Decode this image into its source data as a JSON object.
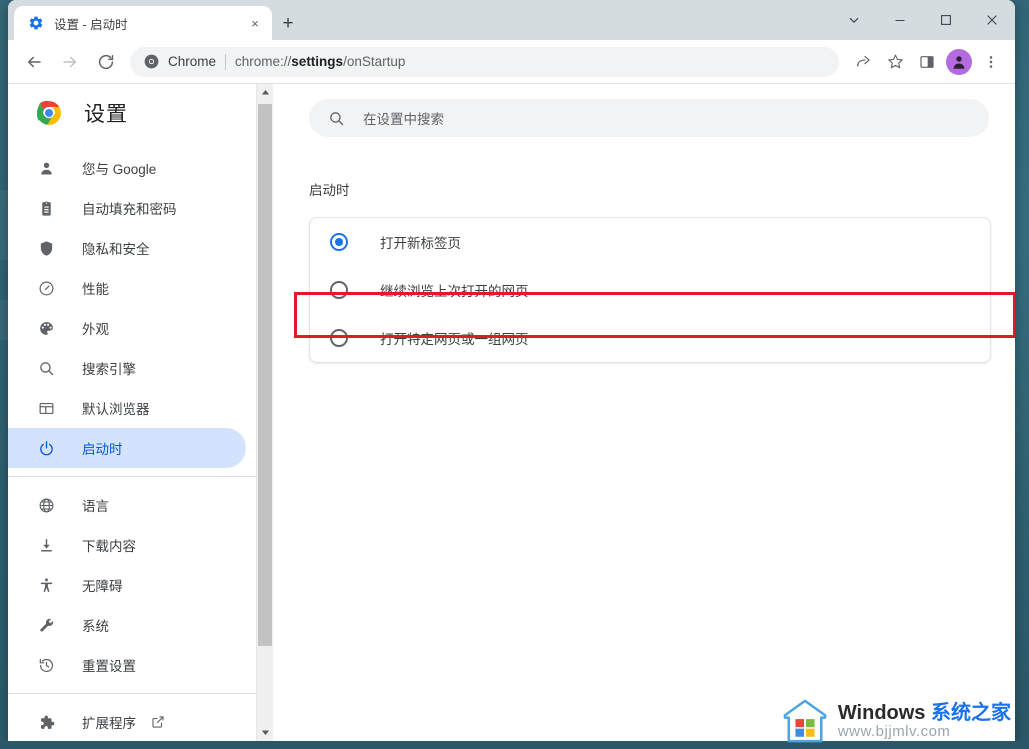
{
  "window": {
    "controls": [
      {
        "name": "tab-search-button",
        "glyph": "chevron-down"
      },
      {
        "name": "minimize-button",
        "glyph": "minimize"
      },
      {
        "name": "maximize-button",
        "glyph": "maximize"
      },
      {
        "name": "close-button",
        "glyph": "close"
      }
    ]
  },
  "tab": {
    "title": "设置 - 启动时",
    "favicon": "gear-icon",
    "close_label": "×",
    "new_tab_label": "+"
  },
  "toolbar": {
    "back_label": "←",
    "forward_label": "→",
    "reload_label": "↻",
    "omnibox": {
      "scheme_label": "Chrome",
      "url_prefix": "chrome://",
      "url_bold": "settings",
      "url_suffix": "/onStartup",
      "full_url": "chrome://settings/onStartup"
    },
    "icons": [
      {
        "name": "share-icon"
      },
      {
        "name": "bookmark-star-icon"
      },
      {
        "name": "side-panel-icon"
      },
      {
        "name": "profile-avatar"
      },
      {
        "name": "chrome-menu-icon"
      }
    ]
  },
  "sidebar": {
    "brand_title": "设置",
    "brand_logo": "chrome-logo",
    "items": [
      {
        "label": "您与 Google",
        "icon": "person-icon",
        "selected": false
      },
      {
        "label": "自动填充和密码",
        "icon": "clipboard-icon",
        "selected": false
      },
      {
        "label": "隐私和安全",
        "icon": "shield-icon",
        "selected": false
      },
      {
        "label": "性能",
        "icon": "speedometer-icon",
        "selected": false
      },
      {
        "label": "外观",
        "icon": "palette-icon",
        "selected": false
      },
      {
        "label": "搜索引擎",
        "icon": "search-icon",
        "selected": false
      },
      {
        "label": "默认浏览器",
        "icon": "browser-window-icon",
        "selected": false
      },
      {
        "label": "启动时",
        "icon": "power-icon",
        "selected": true
      }
    ],
    "items2": [
      {
        "label": "语言",
        "icon": "globe-icon"
      },
      {
        "label": "下载内容",
        "icon": "download-icon"
      },
      {
        "label": "无障碍",
        "icon": "accessibility-icon"
      },
      {
        "label": "系统",
        "icon": "wrench-icon"
      },
      {
        "label": "重置设置",
        "icon": "history-restore-icon"
      }
    ],
    "items3": [
      {
        "label": "扩展程序",
        "icon": "puzzle-icon",
        "external": "external-link-icon"
      }
    ]
  },
  "search": {
    "placeholder": "在设置中搜索",
    "icon": "search-icon"
  },
  "main": {
    "section_title": "启动时",
    "radio_options": [
      {
        "label": "打开新标签页",
        "checked": true
      },
      {
        "label": "继续浏览上次打开的网页",
        "checked": false
      },
      {
        "label": "打开特定网页或一组网页",
        "checked": false
      }
    ]
  },
  "annotation": {
    "name": "red-highlight-box",
    "color": "#e01b24"
  },
  "watermark": {
    "line1_en": "Windows ",
    "line1_cn": "系统之家",
    "line2": "www.bjjmlv.com",
    "logo": "windows-house-logo"
  },
  "colors": {
    "accent_blue": "#1a73e8",
    "selected_pill": "#d3e3fd",
    "selected_text": "#0b57d0",
    "annotation_red": "#e01b24",
    "desktop_teal": "#2f6272"
  }
}
